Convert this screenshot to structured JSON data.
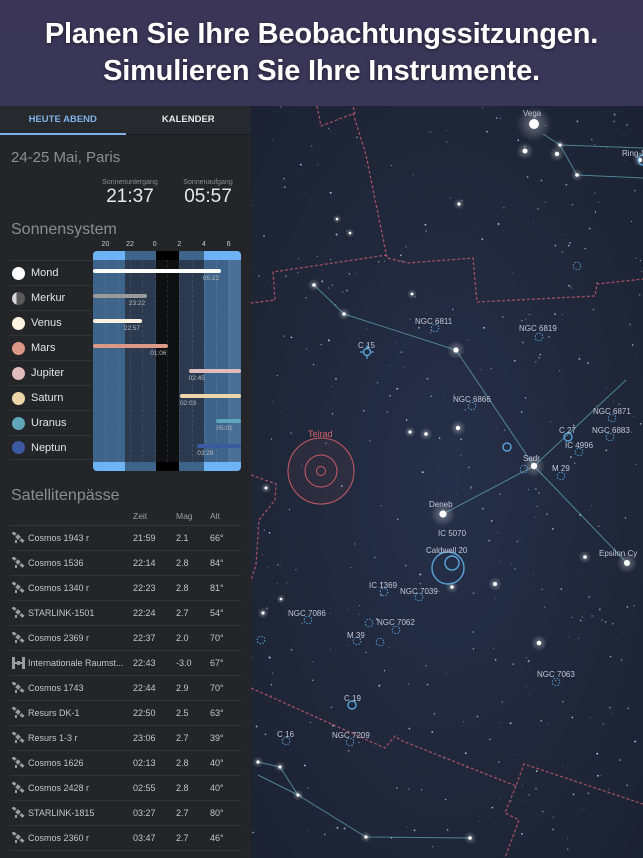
{
  "banner": {
    "line1": "Planen Sie Ihre Beobachtungssitzungen.",
    "line2": "Simulieren Sie Ihre Instrumente."
  },
  "tabs": [
    {
      "label": "HEUTE ABEND",
      "active": true
    },
    {
      "label": "KALENDER",
      "active": false
    }
  ],
  "tonight": {
    "date_location": "24-25 Mai, Paris",
    "sunset_label": "Sonnenuntergang",
    "sunset_time": "21:37",
    "sunrise_label": "Sonnenaufgang",
    "sunrise_time": "05:57"
  },
  "solar_system": {
    "title": "Sonnensystem",
    "hour_ticks": [
      "20",
      "22",
      "0",
      "2",
      "4",
      "6"
    ],
    "planets": [
      {
        "name": "Mond",
        "color": "#ffffff",
        "icon": "moon-full-icon",
        "bar_start_hour": 19.0,
        "bar_end_hour": 29.37,
        "label": "05:22"
      },
      {
        "name": "Merkur",
        "color": "#9a9a9a",
        "icon": "mercury-half-icon",
        "bar_start_hour": 19.0,
        "bar_end_hour": 23.37,
        "label": "23:22"
      },
      {
        "name": "Venus",
        "color": "#fdf3e0",
        "icon": "venus-icon",
        "bar_start_hour": 19.0,
        "bar_end_hour": 22.95,
        "label": "22:57"
      },
      {
        "name": "Mars",
        "color": "#de9887",
        "icon": "mars-icon",
        "bar_start_hour": 19.0,
        "bar_end_hour": 25.1,
        "label": "01:06"
      },
      {
        "name": "Jupiter",
        "color": "#e0bcbc",
        "icon": "jupiter-icon",
        "bar_start_hour": 26.75,
        "bar_end_hour": 31.0,
        "label": "02:45"
      },
      {
        "name": "Saturn",
        "color": "#ecd5a8",
        "icon": "saturn-icon",
        "bar_start_hour": 26.05,
        "bar_end_hour": 31.0,
        "label": "02:03"
      },
      {
        "name": "Uranus",
        "color": "#5fa6b8",
        "icon": "uranus-icon",
        "bar_start_hour": 29.0,
        "bar_end_hour": 31.0,
        "label": "05:01"
      },
      {
        "name": "Neptun",
        "color": "#3b5aa0",
        "icon": "neptune-icon",
        "bar_start_hour": 27.45,
        "bar_end_hour": 31.0,
        "label": "03:28"
      }
    ]
  },
  "satellites": {
    "title": "Satellitenpässe",
    "columns": {
      "time": "Zeit",
      "mag": "Mag",
      "alt": "Alt"
    },
    "rows": [
      {
        "name": "Cosmos 1943 r",
        "time": "21:59",
        "mag": "2.1",
        "alt": "66°",
        "icon": "satellite-icon"
      },
      {
        "name": "Cosmos 1536",
        "time": "22:14",
        "mag": "2.8",
        "alt": "84°",
        "icon": "satellite-icon"
      },
      {
        "name": "Cosmos 1340 r",
        "time": "22:23",
        "mag": "2.8",
        "alt": "81°",
        "icon": "satellite-icon"
      },
      {
        "name": "STARLINK-1501",
        "time": "22:24",
        "mag": "2.7",
        "alt": "54°",
        "icon": "satellite-icon"
      },
      {
        "name": "Cosmos 2369 r",
        "time": "22:37",
        "mag": "2.0",
        "alt": "70°",
        "icon": "satellite-icon"
      },
      {
        "name": "Internationale Raumst...",
        "time": "22:43",
        "mag": "-3.0",
        "alt": "67°",
        "icon": "space-station-icon"
      },
      {
        "name": "Cosmos 1743",
        "time": "22:44",
        "mag": "2.9",
        "alt": "70°",
        "icon": "satellite-icon"
      },
      {
        "name": "Resurs DK-1",
        "time": "22:50",
        "mag": "2.5",
        "alt": "63°",
        "icon": "satellite-icon"
      },
      {
        "name": "Resurs 1-3 r",
        "time": "23:06",
        "mag": "2.7",
        "alt": "39°",
        "icon": "satellite-icon"
      },
      {
        "name": "Cosmos 1626",
        "time": "02:13",
        "mag": "2.8",
        "alt": "40°",
        "icon": "satellite-icon"
      },
      {
        "name": "Cosmos 2428 r",
        "time": "02:55",
        "mag": "2.8",
        "alt": "40°",
        "icon": "satellite-icon"
      },
      {
        "name": "STARLINK-1815",
        "time": "03:27",
        "mag": "2.7",
        "alt": "80°",
        "icon": "satellite-icon"
      },
      {
        "name": "Cosmos 2360 r",
        "time": "03:47",
        "mag": "2.7",
        "alt": "46°",
        "icon": "satellite-icon"
      }
    ]
  },
  "sky_map": {
    "labels": {
      "vega": "Vega",
      "ring": "Ring-N",
      "ngc6811": "NGC 6811",
      "ngc6819": "NGC 6819",
      "c15": "C 15",
      "ngc6866": "NGC 6866",
      "ngc6871": "NGC 6871",
      "c27": "C 27",
      "ngc6883": "NGC 6883",
      "ic4996": "IC 4996",
      "sadr": "Sadr",
      "m29": "M 29",
      "telrad": "Telrad",
      "deneb": "Deneb",
      "ic5070": "IC 5070",
      "caldwell20": "Caldwell 20",
      "epsilon": "Epsilon Cy",
      "ic1369": "IC 1369",
      "ngc7039": "NGC 7039",
      "ngc7086": "NGC 7086",
      "ngc7062": "NGC 7062",
      "m39": "M 39",
      "ngc7063": "NGC 7063",
      "c19": "C 19",
      "c16": "C 16",
      "ngc7209": "NGC 7209"
    },
    "colors": {
      "constellation_line": "#5c9bab",
      "boundary": "#b8566a",
      "dso": "#5aa5dc",
      "telrad": "#d9626a"
    }
  }
}
